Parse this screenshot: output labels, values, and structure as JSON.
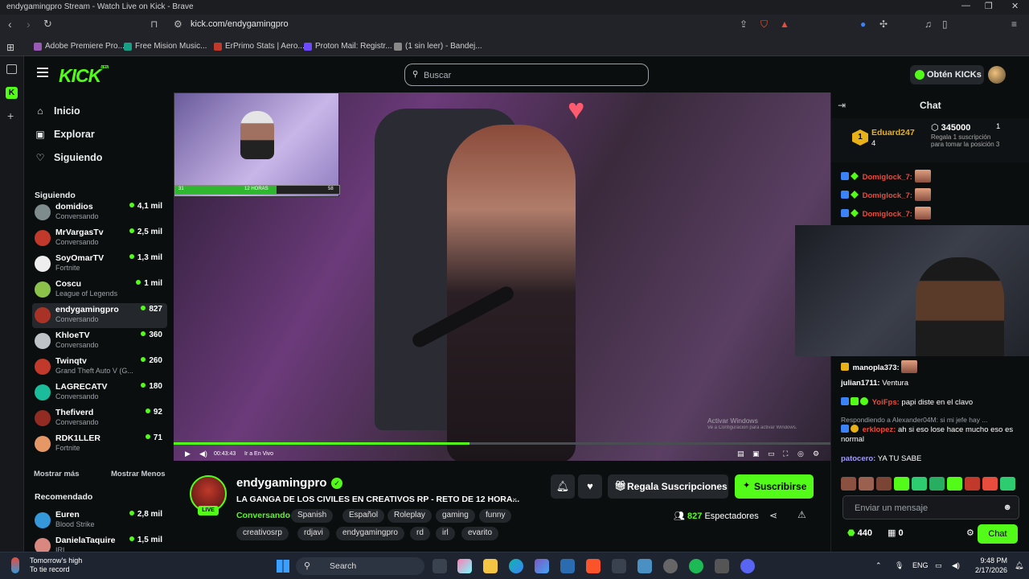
{
  "browser": {
    "window_title": "endygamingpro Stream - Watch Live on Kick - Brave",
    "url": "kick.com/endygamingpro",
    "bookmarks": [
      {
        "label": "Adobe Premiere Pro...",
        "color": "#9b59b6"
      },
      {
        "label": "Free Mision Music...",
        "color": "#16a085"
      },
      {
        "label": "ErPrimo Stats | Aero...",
        "color": "#c0392b"
      },
      {
        "label": "Proton Mail: Registr...",
        "color": "#6d4aff"
      },
      {
        "label": "(1 sin leer) - Bandej...",
        "color": "#888888"
      }
    ]
  },
  "header": {
    "logo": "KICK",
    "logo_sup": "BETA",
    "search_placeholder": "Buscar",
    "kicks_button": "Obtén KICKs"
  },
  "sidebar": {
    "nav": [
      {
        "label": "Inicio",
        "icon": "home-icon",
        "glyph": "⌂"
      },
      {
        "label": "Explorar",
        "icon": "compass-icon",
        "glyph": "▣"
      },
      {
        "label": "Siguiendo",
        "icon": "heart-icon",
        "glyph": "♡"
      }
    ],
    "following_title": "Siguiendo",
    "following": [
      {
        "name": "domidios",
        "game": "Conversando",
        "viewers": "4,1 mil",
        "color": "#7f8c8d"
      },
      {
        "name": "MrVargasTv",
        "game": "Conversando",
        "viewers": "2,5 mil",
        "color": "#c0392b"
      },
      {
        "name": "SoyOmarTV",
        "game": "Fortnite",
        "viewers": "1,3 mil",
        "color": "#eeeeee"
      },
      {
        "name": "Coscu",
        "game": "League of Legends",
        "viewers": "1 mil",
        "color": "#8bc34a"
      },
      {
        "name": "endygamingpro",
        "game": "Conversando",
        "viewers": "827",
        "color": "#a93226"
      },
      {
        "name": "KhloeTV",
        "game": "Conversando",
        "viewers": "360",
        "color": "#bdc3c7"
      },
      {
        "name": "Twinqtv",
        "game": "Grand Theft Auto V (G...",
        "viewers": "260",
        "color": "#c0392b"
      },
      {
        "name": "LAGRECATV",
        "game": "Conversando",
        "viewers": "180",
        "color": "#1abc9c"
      },
      {
        "name": "Thefiverd",
        "game": "Conversando",
        "viewers": "92",
        "color": "#922b21"
      },
      {
        "name": "RDK1LLER",
        "game": "Fortnite",
        "viewers": "71",
        "color": "#e59866"
      }
    ],
    "show_more": "Mostrar más",
    "show_less": "Mostrar Menos",
    "recommended_title": "Recomendado",
    "recommended": [
      {
        "name": "Euren",
        "game": "Blood Strike",
        "viewers": "2,8 mil",
        "color": "#3498db"
      },
      {
        "name": "DanielaTaquire",
        "game": "IRL",
        "viewers": "1,5 mil",
        "color": "#d98880"
      }
    ]
  },
  "player": {
    "pip_left": "31",
    "pip_mid": "12 HORAS",
    "pip_right": "58",
    "pip_progress": 0.62,
    "time": "00:43:43",
    "live_link": "Ir a En Vivo",
    "progress": 0.45,
    "watermark_title": "Activar Windows",
    "watermark_sub": "Ve a Configuración para activar Windows."
  },
  "stream": {
    "streamer": "endygamingpro",
    "live_badge": "LIVE",
    "title": "LA GANGA DE LOS CIVILES EN CREATIVOS RP - RETO DE 12 HORA...",
    "category": "Conversando",
    "tags_row1": [
      "Spanish",
      "Español",
      "Roleplay",
      "gaming",
      "funny"
    ],
    "tags_row2": [
      "creativosrp",
      "rdjavi",
      "endygamingpro",
      "rd",
      "irl",
      "evarito"
    ],
    "gift_label": "Regala Suscripciones",
    "subscribe_label": "Suscribirse",
    "viewer_count": "827",
    "viewer_label": "Espectadores"
  },
  "chat": {
    "title": "Chat",
    "pinned": {
      "rank": "1",
      "user": "Eduard247",
      "count": "4",
      "kicks": "345000",
      "note": "Regala 1 suscripción para tomar la posición 3",
      "position": "1"
    },
    "top_messages": [
      {
        "user": "Domiglock_7:"
      },
      {
        "user": "Domiglock_7:"
      },
      {
        "user": "Domiglock_7:"
      }
    ],
    "messages": [
      {
        "user": "manopla373:",
        "text": "",
        "color": "#ffffff"
      },
      {
        "user": "julian1711:",
        "text": "Ventura",
        "color": "#ffffff"
      },
      {
        "user": "YoiFps:",
        "text": "papi diste en el clavo",
        "color": "#e74c3c"
      },
      {
        "user": "erklopez:",
        "text": "ah si eso lose hace mucho eso es normal",
        "color": "#e74c3c"
      },
      {
        "user": "patocero:",
        "text": "YA TU SABE",
        "color": "#a29bfe"
      }
    ],
    "reply_note": "Respondiendo a Alexander04M: si mi jefe hay ...",
    "input_placeholder": "Enviar un mensaje",
    "kicks_balance": "440",
    "subs_balance": "0",
    "chat_button": "Chat"
  },
  "taskbar": {
    "weather_title": "Tomorrow's high",
    "weather_sub": "To tie record",
    "search": "Search",
    "lang": "ENG",
    "time": "9:48 PM",
    "date": "2/17/2026"
  }
}
